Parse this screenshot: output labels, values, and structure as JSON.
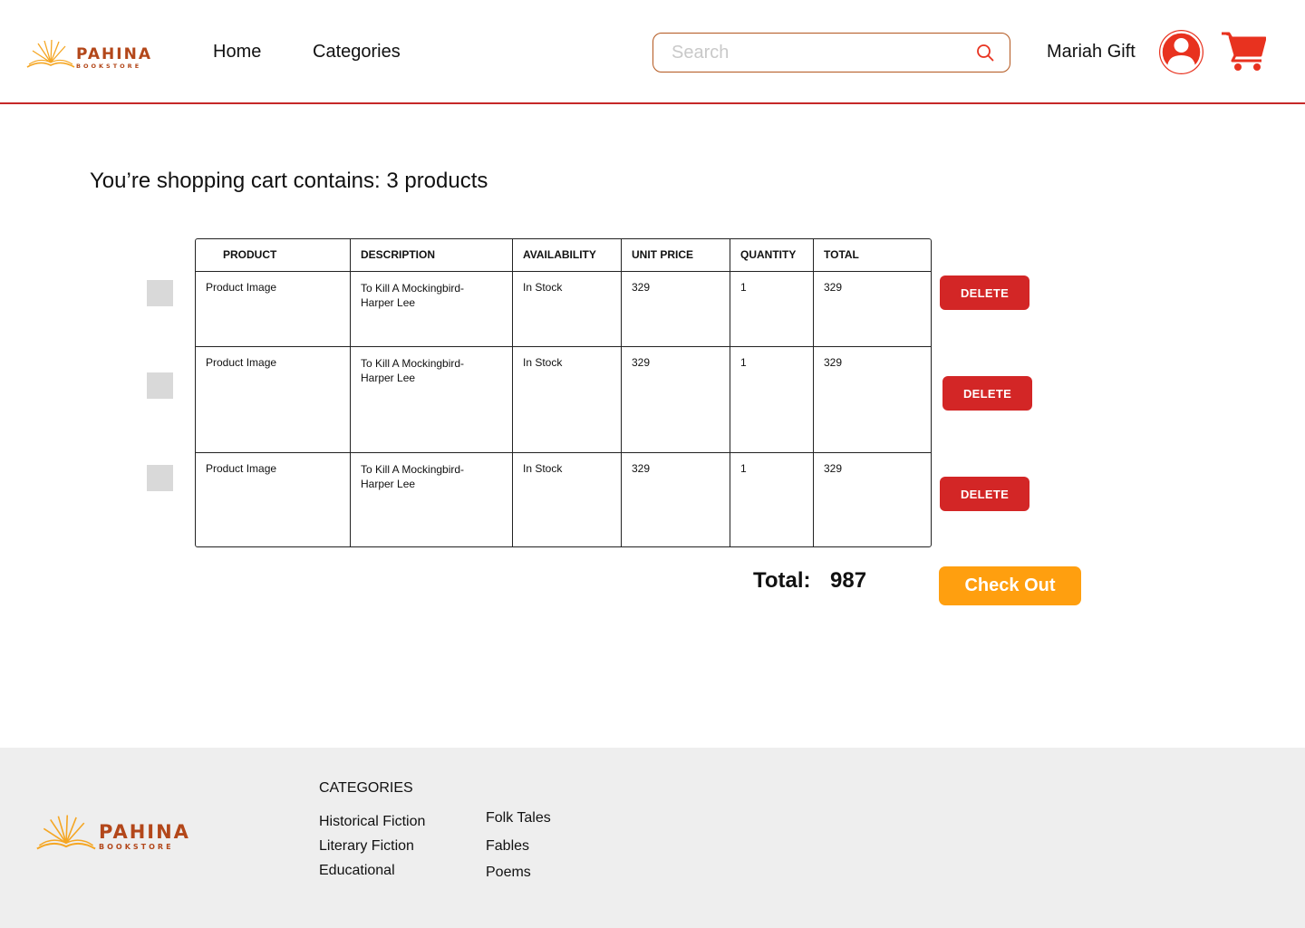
{
  "brand": {
    "name": "PAHINA",
    "tagline": "BOOKSTORE",
    "color": "#b3471a",
    "accent": "#f5a623"
  },
  "nav": {
    "home": "Home",
    "categories": "Categories"
  },
  "search": {
    "placeholder": "Search",
    "value": ""
  },
  "user": {
    "name": "Mariah Gift"
  },
  "cart": {
    "title": "You’re shopping cart contains: 3 products",
    "headers": [
      "PRODUCT",
      "DESCRIPTION",
      "AVAILABILITY",
      "UNIT PRICE",
      "QUANTITY",
      "TOTAL"
    ],
    "rows": [
      {
        "product": "Product Image",
        "description": "To Kill A Mockingbird- Harper Lee",
        "availability": "In Stock",
        "unit_price": "329",
        "quantity": "1",
        "total": "329"
      },
      {
        "product": "Product Image",
        "description": "To Kill A Mockingbird- Harper Lee",
        "availability": "In Stock",
        "unit_price": "329",
        "quantity": "1",
        "total": "329"
      },
      {
        "product": "Product Image",
        "description": "To Kill A Mockingbird- Harper Lee",
        "availability": "In Stock",
        "unit_price": "329",
        "quantity": "1",
        "total": "329"
      }
    ],
    "delete_label": "DELETE",
    "total_label": "Total:",
    "total_value": "987",
    "checkout_label": "Check Out"
  },
  "footer": {
    "heading": "CATEGORIES",
    "col1": [
      "Historical Fiction",
      "Literary Fiction",
      "Educational"
    ],
    "col2": [
      "Folk Tales",
      "Fables",
      "Poems"
    ]
  },
  "colors": {
    "header_rule": "#c62828",
    "delete": "#d32626",
    "checkout": "#ff9f0f",
    "icon": "#e8321f",
    "footer_bg": "#eeeeee"
  }
}
